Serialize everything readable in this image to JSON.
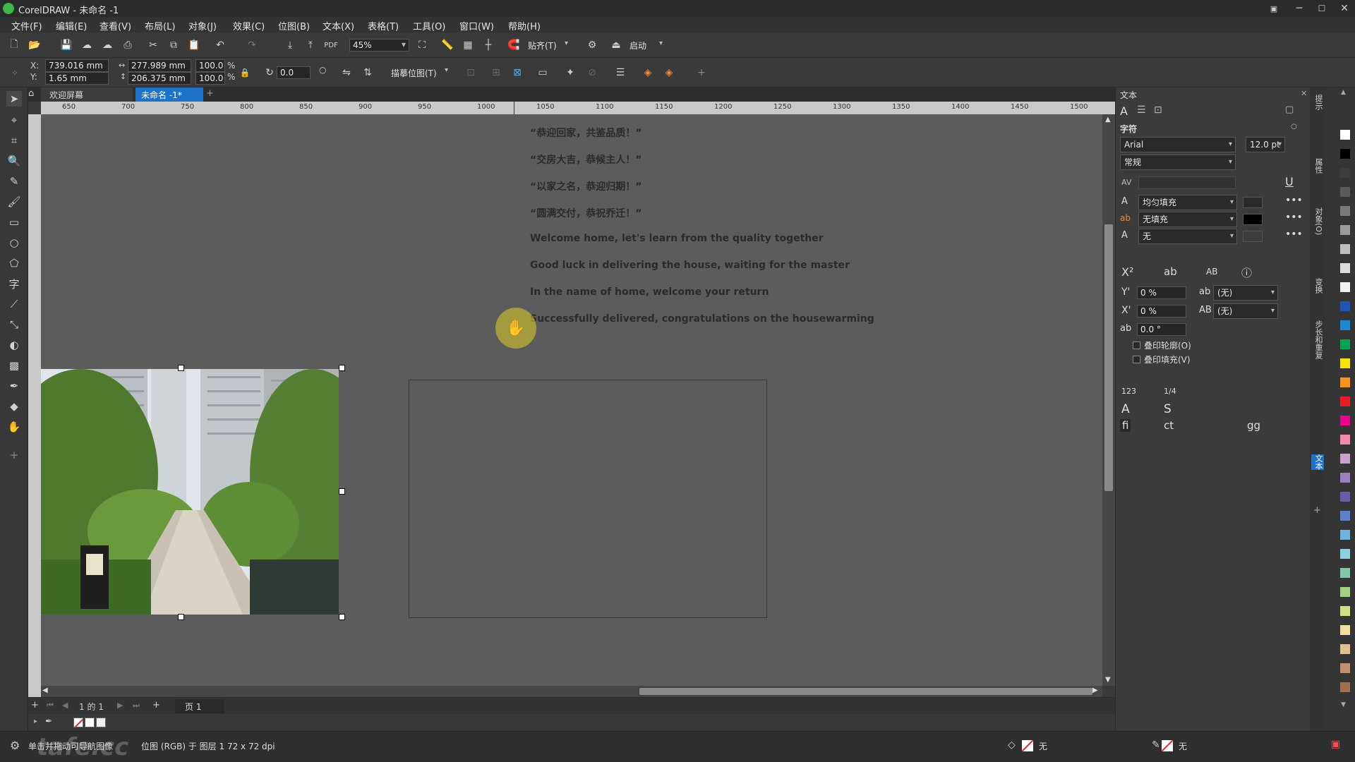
{
  "app": {
    "title": "CorelDRAW - 未命名 -1"
  },
  "menu": [
    "文件(F)",
    "编辑(E)",
    "查看(V)",
    "布局(L)",
    "对象(J)",
    "效果(C)",
    "位图(B)",
    "文本(X)",
    "表格(T)",
    "工具(O)",
    "窗口(W)",
    "帮助(H)"
  ],
  "toolbar": {
    "zoom": "45%",
    "snap_label": "贴齐(T)",
    "launch_label": "启动"
  },
  "props": {
    "x_label": "X:",
    "x": "739.016 mm",
    "y_label": "Y:",
    "y": "1.65 mm",
    "w": "277.989 mm",
    "h": "206.375 mm",
    "sx": "100.0",
    "sy": "100.0",
    "pct": "%",
    "angle": "0.0",
    "trace_label": "描摹位图(T)"
  },
  "tabs": {
    "welcome": "欢迎屏幕",
    "document": "未命名 -1*"
  },
  "ruler": {
    "h_ticks": [
      "650",
      "700",
      "750",
      "800",
      "850",
      "900",
      "950",
      "1000",
      "1050",
      "1100",
      "1150",
      "1200",
      "1250",
      "1300",
      "1350",
      "1400",
      "1450",
      "1500"
    ]
  },
  "canvas": {
    "text_lines": [
      "“恭迎回家，共鉴品质！”",
      "“交房大吉，恭候主人！”",
      "“以家之名，恭迎归期！”",
      "“圆满交付，恭祝乔迁！”",
      "Welcome home, let's learn from the quality together",
      "Good luck in delivering the house, waiting for the master",
      "In the name of home, welcome your return",
      "Successfully delivered, congratulations on the housewarming"
    ]
  },
  "pages": {
    "count": "1 的 1",
    "page": "页 1"
  },
  "status": {
    "hint": "单击并拖动可导航图像",
    "info": "位图 (RGB) 于 图层 1 72 x 72 dpi",
    "fill": "无",
    "outline": "无",
    "watermark": "tafe.cc"
  },
  "docker": {
    "title": "文本",
    "section": "字符",
    "font": "Arial",
    "size": "12.0 pt",
    "style": "常规",
    "fill1": "均匀填充",
    "fill2": "无填充",
    "fill3": "无",
    "y_offset": "0 %",
    "x_offset": "0 %",
    "rotation": "0.0 °",
    "sel_none1": "(无)",
    "sel_none2": "(无)",
    "overprint_outline": "叠印轮廓(O)",
    "overprint_fill": "叠印填充(V)"
  },
  "docker_tabs": [
    "提示",
    "属性",
    "对象(O)",
    "变换",
    "步长和重复",
    "文本"
  ],
  "palette": [
    "#ffffff",
    "#000000",
    "#3d3d3d",
    "#5a5a5a",
    "#7a7a7a",
    "#9a9a9a",
    "#bcbcbc",
    "#dcdcdc",
    "#f0f0f0",
    "#1d56b8",
    "#1e88d8",
    "#00a651",
    "#f5e400",
    "#f7941d",
    "#ed1c24",
    "#ec008c",
    "#f08aa8",
    "#c8a2c8",
    "#9b7fc0",
    "#6a5aa8",
    "#5f7fcf",
    "#6fb3e0",
    "#89d0e0",
    "#7fc9a8",
    "#a0d080",
    "#d0e080",
    "#f0e0a0",
    "#e0c090",
    "#c09070",
    "#a07050"
  ]
}
